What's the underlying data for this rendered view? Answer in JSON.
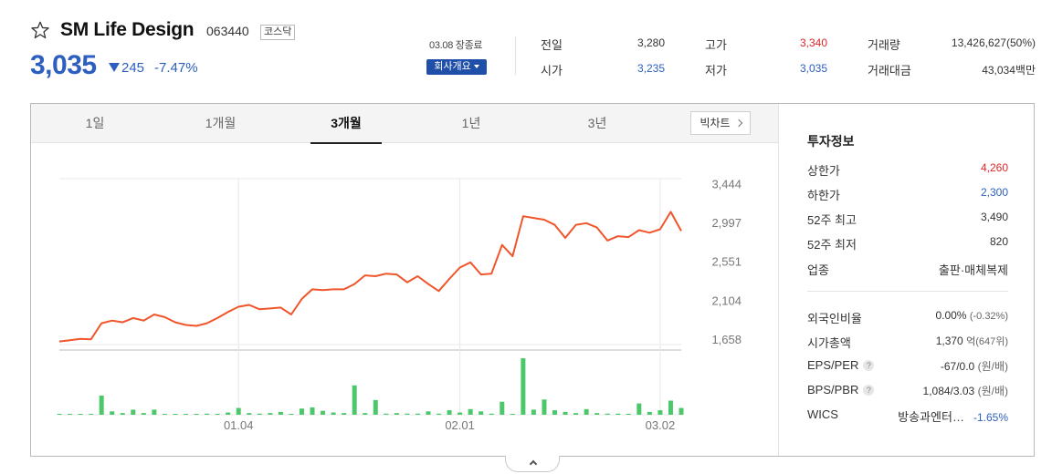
{
  "header": {
    "company_name": "SM Life Design",
    "stock_code": "063440",
    "market": "코스닥",
    "price": "3,035",
    "change": "245",
    "change_rate": "-7.47%",
    "closed_label": "03.08 장종료",
    "overview_button": "회사개요",
    "trend_color": "#2c5fbf"
  },
  "quote": {
    "prev_close_label": "전일",
    "prev_close": "3,280",
    "open_label": "시가",
    "open": "3,235",
    "high_label": "고가",
    "high": "3,340",
    "low_label": "저가",
    "low": "3,035",
    "volume_label": "거래량",
    "volume": "13,426,627(50%)",
    "amount_label": "거래대금",
    "amount": "43,034백만"
  },
  "tabs": [
    {
      "label": "1일"
    },
    {
      "label": "1개월"
    },
    {
      "label": "3개월",
      "active": true
    },
    {
      "label": "1년"
    },
    {
      "label": "3년"
    }
  ],
  "big_chart_button": "빅차트",
  "investment": {
    "title": "투자정보",
    "upper_limit_label": "상한가",
    "upper_limit": "4,260",
    "lower_limit_label": "하한가",
    "lower_limit": "2,300",
    "high52_label": "52주 최고",
    "high52": "3,490",
    "low52_label": "52주 최저",
    "low52": "820",
    "industry_label": "업종",
    "industry": "출판·매체복제",
    "foreign_label": "외국인비율",
    "foreign_rate": "0.00%",
    "foreign_change": "(-0.32%)",
    "market_cap_label": "시가총액",
    "market_cap": "1,370",
    "market_cap_unit": "억",
    "market_cap_rank": "(647위)",
    "eps_label": "EPS/PER",
    "eps_per": "-67/0.0",
    "eps_unit": "(원/배)",
    "bps_label": "BPS/PBR",
    "bps_pbr": "1,084/3.03",
    "bps_unit": "(원/배)",
    "wics_label": "WICS",
    "wics": "방송과엔터…",
    "wics_change": "-1.65%",
    "up_color": "#e0262a",
    "down_color": "#2c5fbf"
  },
  "chart_data": {
    "type": "line",
    "title": "",
    "y_ticks": [
      "3,444",
      "2,997",
      "2,551",
      "2,104",
      "1,658"
    ],
    "y_tick_values": [
      3444,
      2997,
      2551,
      2104,
      1658
    ],
    "ylim": [
      1500,
      3700
    ],
    "x_ticks": [
      "01.04",
      "02.01",
      "03.02"
    ],
    "x_tick_index": [
      17,
      38,
      57
    ],
    "line_color": "#f0552b",
    "volume_color": "#4cc86b",
    "grid": true,
    "price": [
      1640,
      1655,
      1670,
      1665,
      1850,
      1880,
      1860,
      1910,
      1880,
      1950,
      1920,
      1860,
      1830,
      1820,
      1850,
      1910,
      1980,
      2040,
      2060,
      2010,
      2020,
      2030,
      1950,
      2130,
      2240,
      2230,
      2240,
      2240,
      2300,
      2400,
      2390,
      2420,
      2410,
      2320,
      2390,
      2300,
      2220,
      2360,
      2490,
      2550,
      2410,
      2420,
      2750,
      2620,
      3080,
      3060,
      3040,
      2980,
      2830,
      2980,
      3000,
      2950,
      2800,
      2850,
      2840,
      2920,
      2890,
      2930,
      3130,
      2910
    ],
    "volume": [
      0.01,
      0.01,
      0.01,
      0.01,
      0.34,
      0.06,
      0.03,
      0.09,
      0.03,
      0.09,
      0.01,
      0.01,
      0.01,
      0.01,
      0.02,
      0.01,
      0.04,
      0.12,
      0.03,
      0.02,
      0.03,
      0.05,
      0.01,
      0.11,
      0.13,
      0.07,
      0.04,
      0.03,
      0.52,
      0.03,
      0.26,
      0.02,
      0.03,
      0.02,
      0.02,
      0.06,
      0.02,
      0.08,
      0.04,
      0.1,
      0.06,
      0.02,
      0.23,
      0.01,
      1.0,
      0.09,
      0.27,
      0.08,
      0.05,
      0.03,
      0.1,
      0.03,
      0.02,
      0.02,
      0.01,
      0.2,
      0.05,
      0.08,
      0.25,
      0.12
    ]
  }
}
